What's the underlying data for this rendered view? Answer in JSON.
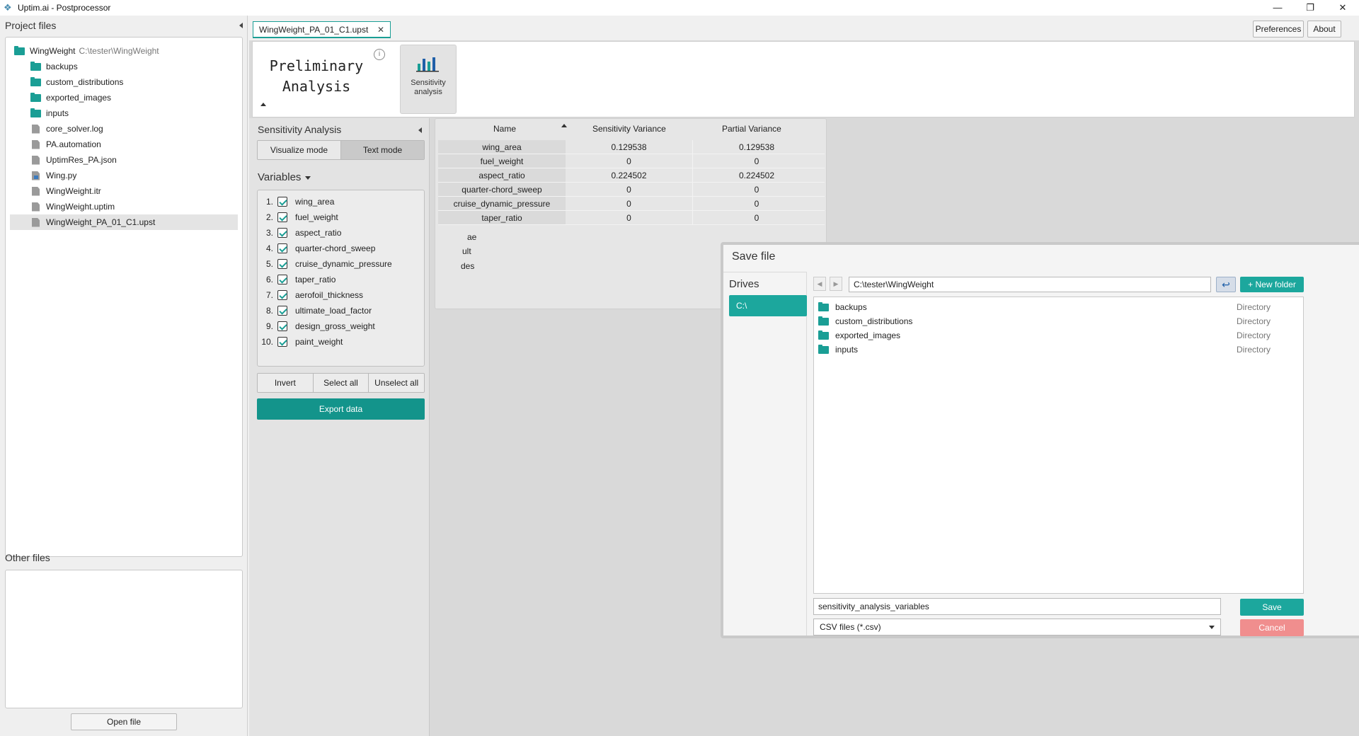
{
  "window": {
    "title": "Uptim.ai - Postprocessor",
    "controls": {
      "minimize": "—",
      "restore": "❐",
      "close": "✕"
    }
  },
  "project_files": {
    "header": "Project files",
    "root": {
      "name": "WingWeight",
      "path": "C:\\tester\\WingWeight"
    },
    "items": [
      {
        "name": "backups",
        "type": "folder"
      },
      {
        "name": "custom_distributions",
        "type": "folder"
      },
      {
        "name": "exported_images",
        "type": "folder"
      },
      {
        "name": "inputs",
        "type": "folder"
      },
      {
        "name": "core_solver.log",
        "type": "file"
      },
      {
        "name": "PA.automation",
        "type": "file"
      },
      {
        "name": "UptimRes_PA.json",
        "type": "file"
      },
      {
        "name": "Wing.py",
        "type": "python"
      },
      {
        "name": "WingWeight.itr",
        "type": "file"
      },
      {
        "name": "WingWeight.uptim",
        "type": "file"
      },
      {
        "name": "WingWeight_PA_01_C1.upst",
        "type": "file"
      }
    ]
  },
  "other_files": {
    "header": "Other files",
    "open_button": "Open file"
  },
  "tabs": {
    "active_tab": "WingWeight_PA_01_C1.upst",
    "close": "✕"
  },
  "top_buttons": {
    "preferences": "Preferences",
    "about": "About"
  },
  "ribbon": {
    "title_line1": "Preliminary",
    "title_line2": "Analysis",
    "info": "i",
    "sensitivity_line1": "Sensitivity",
    "sensitivity_line2": "analysis"
  },
  "sensitivity_panel": {
    "title": "Sensitivity Analysis",
    "visualize_mode": "Visualize mode",
    "text_mode": "Text mode",
    "variables_title": "Variables",
    "variables": [
      {
        "num": "1.",
        "name": "wing_area"
      },
      {
        "num": "2.",
        "name": "fuel_weight"
      },
      {
        "num": "3.",
        "name": "aspect_ratio"
      },
      {
        "num": "4.",
        "name": "quarter-chord_sweep"
      },
      {
        "num": "5.",
        "name": "cruise_dynamic_pressure"
      },
      {
        "num": "6.",
        "name": "taper_ratio"
      },
      {
        "num": "7.",
        "name": "aerofoil_thickness"
      },
      {
        "num": "8.",
        "name": "ultimate_load_factor"
      },
      {
        "num": "9.",
        "name": "design_gross_weight"
      },
      {
        "num": "10.",
        "name": "paint_weight"
      }
    ],
    "invert": "Invert",
    "select_all": "Select all",
    "unselect_all": "Unselect all",
    "export": "Export data"
  },
  "results_table": {
    "headers": {
      "name": "Name",
      "sensitivity": "Sensitivity Variance",
      "partial": "Partial Variance"
    },
    "rows": [
      {
        "name": "wing_area",
        "sensitivity": "0.129538",
        "partial": "0.129538"
      },
      {
        "name": "fuel_weight",
        "sensitivity": "0",
        "partial": "0"
      },
      {
        "name": "aspect_ratio",
        "sensitivity": "0.224502",
        "partial": "0.224502"
      },
      {
        "name": "quarter-chord_sweep",
        "sensitivity": "0",
        "partial": "0"
      },
      {
        "name": "cruise_dynamic_pressure",
        "sensitivity": "0",
        "partial": "0"
      },
      {
        "name": "taper_ratio",
        "sensitivity": "0",
        "partial": "0"
      }
    ],
    "partial_labels": [
      "ae",
      "ult",
      "des"
    ]
  },
  "save_dialog": {
    "title": "Save file",
    "close": "✕",
    "drives_title": "Drives",
    "drives": [
      "C:\\"
    ],
    "nav_back": "◀",
    "nav_forward": "▶",
    "path": "C:\\tester\\WingWeight",
    "up_icon": "↩",
    "new_folder": "+ New folder",
    "entries": [
      {
        "name": "backups",
        "type": "Directory"
      },
      {
        "name": "custom_distributions",
        "type": "Directory"
      },
      {
        "name": "exported_images",
        "type": "Directory"
      },
      {
        "name": "inputs",
        "type": "Directory"
      }
    ],
    "filename": "sensitivity_analysis_variables",
    "save": "Save",
    "filter": "CSV files (*.csv)",
    "cancel": "Cancel"
  },
  "colors": {
    "accent": "#1ca79d",
    "export": "#13948b",
    "cancel": "#f08e8e",
    "close_red": "#e21b1b"
  }
}
